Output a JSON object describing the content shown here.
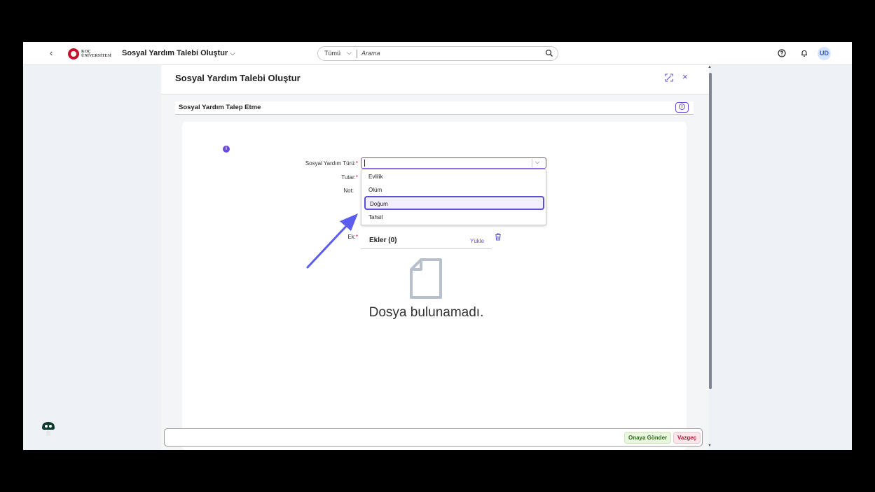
{
  "shell": {
    "back": "‹",
    "logo_text_1": "KOÇ",
    "logo_text_2": "ÜNİVERSİTESİ",
    "app_title": "Sosyal Yardım Talebi Oluştur",
    "app_title_chevron": "⌵",
    "search_scope": "Tümü",
    "search_scope_chevron": "⌵",
    "search_placeholder": "Arama",
    "avatar_initials": "UD"
  },
  "dialog": {
    "title": "Sosyal Yardım Talebi Oluştur",
    "close": "×",
    "section_title": "Sosyal Yardım Talep Etme",
    "info_glyph": "i",
    "form": {
      "type_label": "Sosyal Yardım Türü:",
      "amount_label": "Tutar:",
      "note_label": "Not:",
      "attachment_label": "Ek:",
      "required_mark": "*",
      "type_value": "",
      "type_chevron": "⌵",
      "options": [
        "Evlilik",
        "Ölüm",
        "Doğum",
        "Tahsil"
      ],
      "highlighted_option": "Doğum"
    },
    "attachments": {
      "title": "Ekler (0)",
      "upload_label": "Yükle",
      "empty_text": "Dosya bulunamadı."
    },
    "footer": {
      "submit_label": "Onaya Gönder",
      "cancel_label": "Vazgeç"
    }
  },
  "colors": {
    "accent": "#5b4fd9",
    "required": "#c8102e",
    "submit_bg": "#e9f7de",
    "cancel_bg": "#ffe6ea"
  },
  "icons": [
    "search-icon",
    "help-icon",
    "bell-icon",
    "resize-icon",
    "close-icon",
    "info-icon",
    "trash-icon",
    "file-icon",
    "assistant-icon",
    "pointer-arrow-icon"
  ]
}
